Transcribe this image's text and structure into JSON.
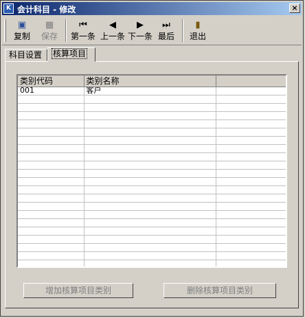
{
  "window": {
    "title": "会计科目 - 修改",
    "close_label": "×",
    "app_icon_label": "K"
  },
  "toolbar": {
    "buttons": [
      {
        "id": "copy",
        "label": "复制",
        "icon": "copy-icon",
        "glyph": "▣",
        "enabled": true,
        "color": "#2a4f9a"
      },
      {
        "id": "save",
        "label": "保存",
        "icon": "save-icon",
        "glyph": "▦",
        "enabled": false,
        "color": "#808080"
      },
      {
        "id": "first",
        "label": "第一条",
        "icon": "first-icon",
        "glyph": "⏮",
        "enabled": true,
        "color": "#000000"
      },
      {
        "id": "prev",
        "label": "上一条",
        "icon": "prev-icon",
        "glyph": "◀",
        "enabled": true,
        "color": "#000000"
      },
      {
        "id": "next",
        "label": "下一条",
        "icon": "next-icon",
        "glyph": "▶",
        "enabled": true,
        "color": "#000000"
      },
      {
        "id": "last",
        "label": "最后",
        "icon": "last-icon",
        "glyph": "⏭",
        "enabled": true,
        "color": "#000000"
      },
      {
        "id": "exit",
        "label": "退出",
        "icon": "exit-door-icon",
        "glyph": "▮",
        "enabled": true,
        "color": "#7a5a10"
      }
    ]
  },
  "tabs": [
    {
      "label": "科目设置",
      "active": false
    },
    {
      "label": "核算项目",
      "active": true
    }
  ],
  "grid": {
    "columns": [
      "类别代码",
      "类别名称",
      ""
    ],
    "rows": [
      [
        "001",
        "客户",
        ""
      ]
    ]
  },
  "actions": {
    "add_label": "增加核算项目类别",
    "delete_label": "删除核算项目类别"
  }
}
